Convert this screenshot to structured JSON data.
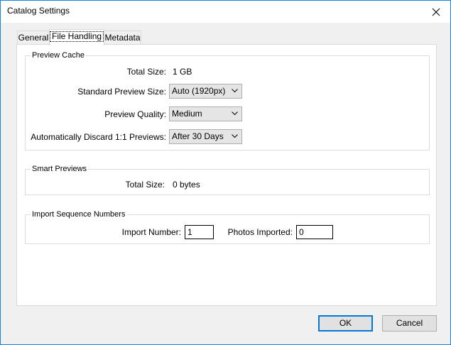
{
  "window": {
    "title": "Catalog Settings"
  },
  "tabs": [
    {
      "label": "General"
    },
    {
      "label": "File Handling",
      "active": true
    },
    {
      "label": "Metadata"
    }
  ],
  "preview_cache": {
    "title": "Preview Cache",
    "total_size_label": "Total Size:",
    "total_size_value": "1 GB",
    "standard_preview_size_label": "Standard Preview Size:",
    "standard_preview_size_value": "Auto (1920px)",
    "preview_quality_label": "Preview Quality:",
    "preview_quality_value": "Medium",
    "discard_label": "Automatically Discard 1:1 Previews:",
    "discard_value": "After 30 Days"
  },
  "smart_previews": {
    "title": "Smart Previews",
    "total_size_label": "Total Size:",
    "total_size_value": "0 bytes"
  },
  "import_sequence": {
    "title": "Import Sequence Numbers",
    "import_number_label": "Import Number:",
    "import_number_value": "1",
    "photos_imported_label": "Photos Imported:",
    "photos_imported_value": "0"
  },
  "buttons": {
    "ok": "OK",
    "cancel": "Cancel"
  },
  "colors": {
    "accent": "#0078d7",
    "window_border": "#1883d7"
  },
  "icons": {
    "close": "close-icon",
    "dropdown": "chevron-down-icon"
  }
}
